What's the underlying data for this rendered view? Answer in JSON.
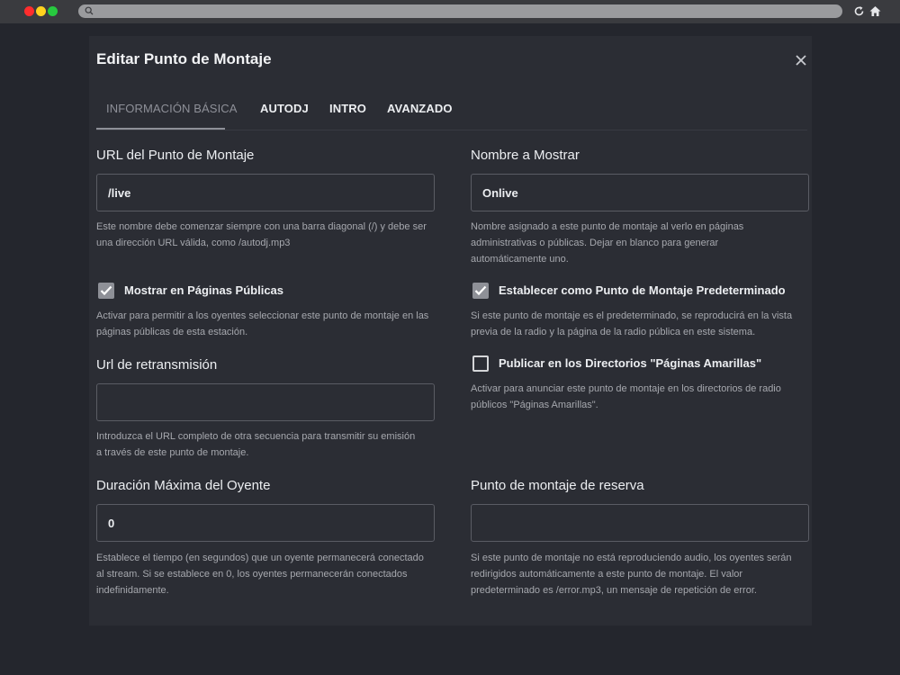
{
  "browser": {
    "icons": [
      "search-icon",
      "reload-icon",
      "home-icon"
    ],
    "dot_colors": [
      "#ff2d2d",
      "#ffd21e",
      "#27c93f"
    ]
  },
  "modal": {
    "title": "Editar Punto de Montaje",
    "close_icon": "close-icon"
  },
  "tabs": [
    {
      "label": "INFORMACIÓN BÁSICA",
      "active": true
    },
    {
      "label": "AUTODJ",
      "active": false
    },
    {
      "label": "INTRO",
      "active": false
    },
    {
      "label": "AVANZADO",
      "active": false
    }
  ],
  "fields": {
    "url": {
      "label": "URL del Punto de Montaje",
      "value": "/live",
      "help": "Este nombre debe comenzar siempre con una barra diagonal (/) y debe ser una dirección URL válida, como /autodj.mp3"
    },
    "display_name": {
      "label": "Nombre a Mostrar",
      "value": "Onlive",
      "help": "Nombre asignado a este punto de montaje al verlo en páginas administrativas o públicas. Dejar en blanco para generar automáticamente uno."
    },
    "show_public": {
      "label": "Mostrar en Páginas Públicas",
      "checked": true,
      "help": "Activar para permitir a los oyentes seleccionar este punto de montaje en las páginas públicas de esta estación."
    },
    "default_mount": {
      "label": "Establecer como Punto de Montaje Predeterminado",
      "checked": true,
      "help": "Si este punto de montaje es el predeterminado, se reproducirá en la vista previa de la radio y la página de la radio pública en este sistema."
    },
    "relay_url": {
      "label": "Url de retransmisión",
      "value": "",
      "help": "Introduzca el URL completo de otra secuencia para transmitir su emisión a través de este punto de montaje."
    },
    "yellow_pages": {
      "label": "Publicar en los Directorios \"Páginas Amarillas\"",
      "checked": false,
      "help": "Activar para anunciar este punto de montaje en los directorios de radio públicos \"Páginas Amarillas\"."
    },
    "max_listener": {
      "label": "Duración Máxima del Oyente",
      "value": "0",
      "help": "Establece el tiempo (en segundos) que un oyente permanecerá conectado al stream. Si se establece en 0, los oyentes permanecerán conectados indefinidamente."
    },
    "fallback_mount": {
      "label": "Punto de montaje de reserva",
      "value": "",
      "help": "Si este punto de montaje no está reproduciendo audio, los oyentes serán redirigidos automáticamente a este punto de montaje. El valor predeterminado es /error.mp3, un mensaje de repetición de error."
    }
  }
}
